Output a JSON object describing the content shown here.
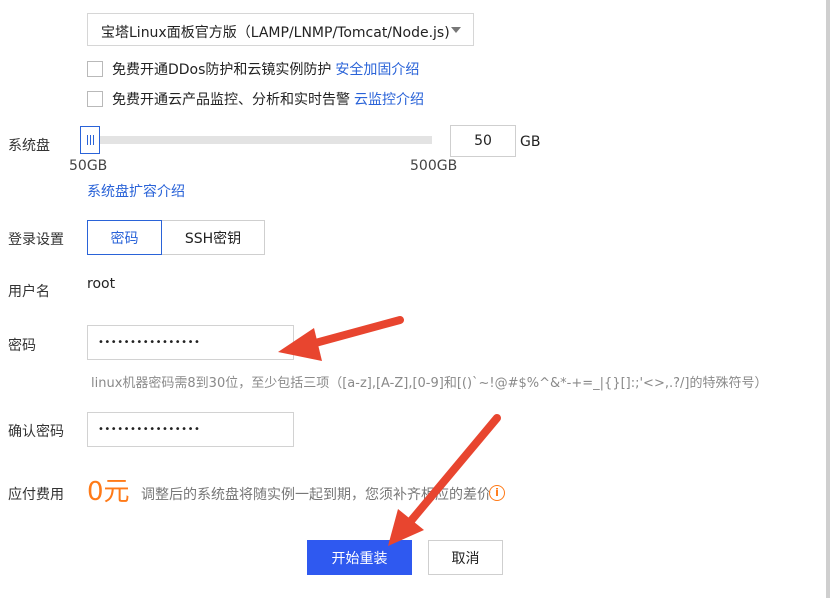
{
  "image_select": {
    "value": "宝塔Linux面板官方版（LAMP/LNMP/Tomcat/Node.js)"
  },
  "options": [
    {
      "text": "免费开通DDos防护和云镜实例防护",
      "link": "安全加固介绍"
    },
    {
      "text": "免费开通云产品监控、分析和实时告警",
      "link": "云监控介绍"
    }
  ],
  "system_disk": {
    "label": "系统盘",
    "min_label": "50GB",
    "max_label": "500GB",
    "value": "50",
    "unit": "GB",
    "expand_link": "系统盘扩容介绍"
  },
  "login": {
    "label": "登录设置",
    "tabs": [
      "密码",
      "SSH密钥"
    ],
    "active_tab": "密码"
  },
  "username": {
    "label": "用户名",
    "value": "root"
  },
  "password": {
    "label": "密码",
    "value": "••••••••••••••••",
    "hint": "linux机器密码需8到30位，至少包括三项（[a-z],[A-Z],[0-9]和[()`~!@#$%^&*-+=_|{}[]:;'<>,.?/]的特殊符号）"
  },
  "confirm_password": {
    "label": "确认密码",
    "value": "••••••••••••••••"
  },
  "fee": {
    "label": "应付费用",
    "amount": "0元",
    "note": "调整后的系统盘将随实例一起到期，您须补齐相应的差价"
  },
  "actions": {
    "submit": "开始重装",
    "cancel": "取消"
  },
  "colors": {
    "accent": "#2f59f0",
    "link": "#2a63d8",
    "price": "#ff7a18",
    "annotation_arrow": "#e8452f"
  }
}
